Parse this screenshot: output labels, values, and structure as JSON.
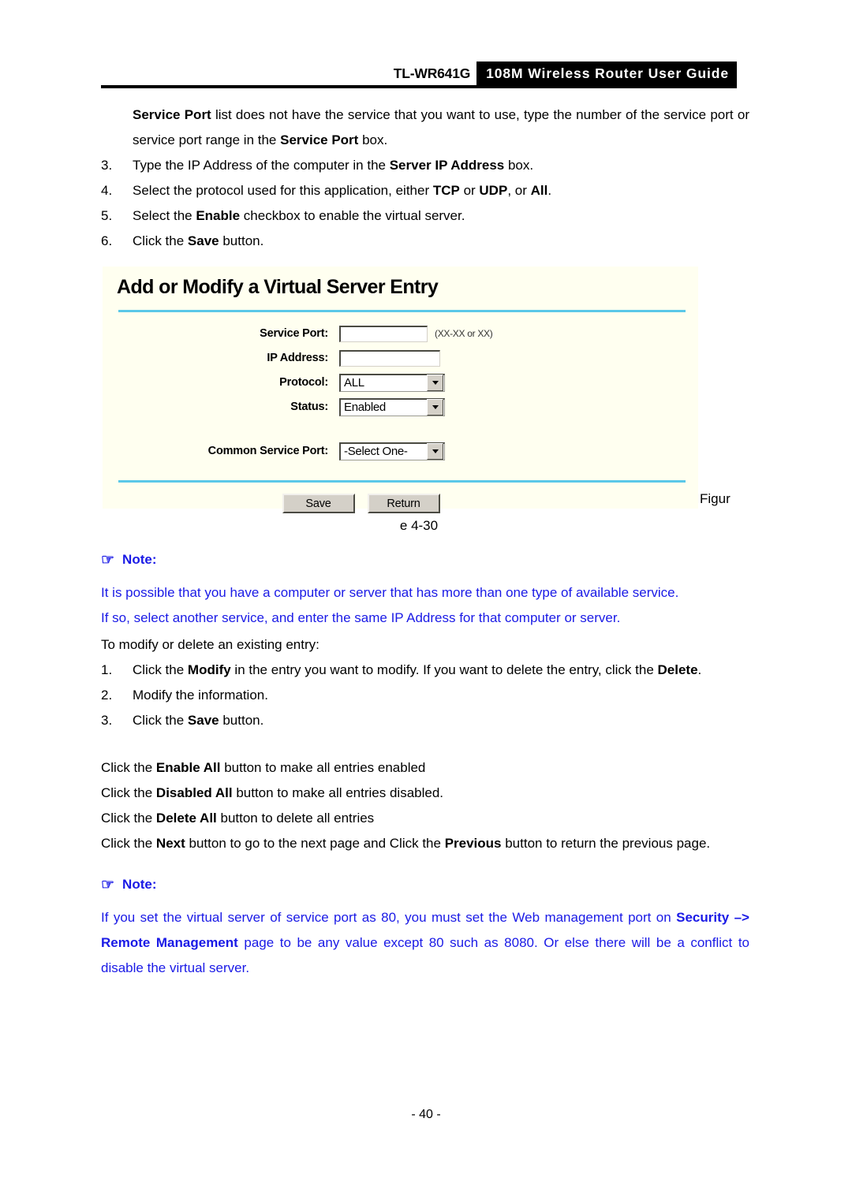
{
  "header": {
    "model": "TL-WR641G",
    "title": "108M Wireless Router User Guide"
  },
  "intro": {
    "line1_pre": "Service Port",
    "line1_post": " list does not have the service that you want to use, type the number of the service port or service port range in the ",
    "line1_bold2": "Service Port",
    "line1_end": " box."
  },
  "steps_top": [
    {
      "num": "3.",
      "pre": "Type the IP Address of the computer in the ",
      "bold": "Server IP Address",
      "post": " box."
    },
    {
      "num": "4.",
      "pre": "Select the protocol used for this application, either ",
      "bold": "TCP",
      "mid": " or ",
      "bold2": "UDP",
      "mid2": ", or ",
      "bold3": "All",
      "post": "."
    },
    {
      "num": "5.",
      "pre": "Select the ",
      "bold": "Enable",
      "post": " checkbox to enable the virtual server."
    },
    {
      "num": "6.",
      "pre": "Click the ",
      "bold": "Save",
      "post": " button."
    }
  ],
  "router_panel": {
    "title": "Add or Modify a Virtual Server Entry",
    "fields": [
      {
        "label": "Service Port:",
        "value": "",
        "hint": "(XX-XX or XX)"
      },
      {
        "label": "IP Address:",
        "value": "",
        "hint": ""
      },
      {
        "label": "Protocol:",
        "value": "ALL"
      },
      {
        "label": "Status:",
        "value": "Enabled"
      },
      {
        "label": "Common Service Port:",
        "value": "-Select One-"
      }
    ],
    "buttons": {
      "save": "Save",
      "return": "Return"
    }
  },
  "figure": {
    "right_fragment": "Figur",
    "wrapped_fragment": "e 4-30"
  },
  "note1": {
    "label": "Note:",
    "icon": "☞",
    "line1": "It is possible that you have a computer or server that has more than one type of available service.",
    "line2": "If so, select another service, and enter the same IP Address for that computer or server."
  },
  "modify_intro": "To modify or delete an existing entry:",
  "steps_modify": [
    {
      "num": "1.",
      "pre": "Click the ",
      "bold": "Modify",
      "mid": " in the entry you want to modify. If you want to delete the entry, click the ",
      "bold2": "Delete",
      "post": "."
    },
    {
      "num": "2.",
      "pre": "Modify the information.",
      "bold": "",
      "post": ""
    },
    {
      "num": "3.",
      "pre": "Click the ",
      "bold": "Save",
      "post": " button."
    }
  ],
  "button_paras": [
    {
      "pre": "Click the ",
      "bold": "Enable All",
      "post": " button to make all entries enabled"
    },
    {
      "pre": "Click the ",
      "bold": "Disabled All",
      "post": " button to make all entries disabled."
    },
    {
      "pre": "Click the ",
      "bold": "Delete All",
      "post": " button to delete all entries"
    }
  ],
  "next_prev_para": {
    "pre": "Click the ",
    "bold": "Next",
    "mid": " button to go to the next page and Click the ",
    "bold2": "Previous",
    "post": " button to return the previous page."
  },
  "note2": {
    "label": "Note:",
    "icon": "☞",
    "pre": "If you set the virtual server of service port as 80, you must set the Web management port on ",
    "bold": "Security –> Remote Management",
    "post": " page to be any value except 80 such as 8080. Or else there will be a conflict to disable the virtual server."
  },
  "footer": {
    "page_number": "- 40 -"
  },
  "colors": {
    "note_blue": "#1a1ae6",
    "panel_bg": "#fffff0",
    "panel_rule": "#5bc8e8",
    "header_bar": "#000000",
    "button_face": "#d4d0c8"
  }
}
